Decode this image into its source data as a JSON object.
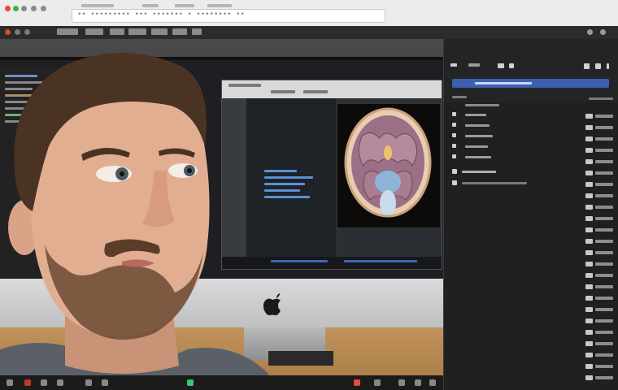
{
  "colors": {
    "panel_accent": "#3d5fb0",
    "screen_bg": "#1d1f22",
    "panel_bg": "#1f2021"
  },
  "browser": {
    "address_text": "•• ••••••••• ••• ••••••• • •••••••• ••"
  },
  "panel": {
    "title": "",
    "search_text": ""
  },
  "taskbar": {
    "icons": [
      "app-icon",
      "app-icon",
      "app-icon",
      "app-icon",
      "app-icon",
      "app-icon",
      "app-icon",
      "app-icon",
      "app-icon"
    ]
  }
}
